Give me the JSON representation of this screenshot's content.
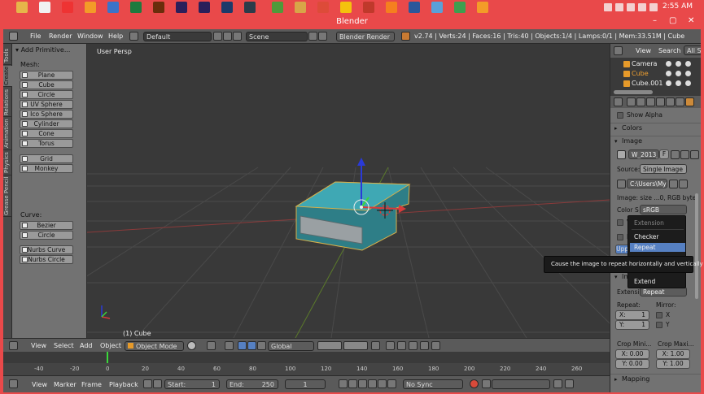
{
  "taskbar": {
    "clock": "2:55 AM",
    "apps": [
      {
        "name": "folder-icon",
        "color": "#e6b64a"
      },
      {
        "name": "gmail-icon",
        "color": "#f1f1f1"
      },
      {
        "name": "pinterest-icon",
        "color": "#e33"
      },
      {
        "name": "vlc-icon",
        "color": "#f39b28"
      },
      {
        "name": "windows-icon",
        "color": "#3b73c8"
      },
      {
        "name": "excel-icon",
        "color": "#1f7a3e"
      },
      {
        "name": "illustrator-icon",
        "color": "#6b2d0b"
      },
      {
        "name": "aftereffects-icon",
        "color": "#2c1f5a"
      },
      {
        "name": "premiere-icon",
        "color": "#2a1f5a"
      },
      {
        "name": "photoshop-icon",
        "color": "#1c3a6a"
      },
      {
        "name": "lightroom-icon",
        "color": "#2b3c4a"
      },
      {
        "name": "app-green-icon",
        "color": "#4f9a3a"
      },
      {
        "name": "folder2-icon",
        "color": "#d8a548"
      },
      {
        "name": "chrome-icon",
        "color": "#dd4b39"
      },
      {
        "name": "chrome2-icon",
        "color": "#f4c20d"
      },
      {
        "name": "app-red-icon",
        "color": "#c0392b"
      },
      {
        "name": "blender-icon",
        "color": "#f57f1f"
      },
      {
        "name": "word-icon",
        "color": "#2b579a"
      },
      {
        "name": "image-icon",
        "color": "#5aa0d8"
      },
      {
        "name": "app-pdf-icon",
        "color": "#3f9f4f"
      },
      {
        "name": "vlc2-icon",
        "color": "#f39b28"
      }
    ]
  },
  "window": {
    "title": "Blender",
    "minimize": "–",
    "maximize": "▢",
    "close": "✕"
  },
  "topbar": {
    "menus": [
      "File",
      "Render",
      "Window",
      "Help"
    ],
    "layout": "Default",
    "scene": "Scene",
    "engine": "Blender Render",
    "stats": "v2.74 | Verts:24 | Faces:16 | Tris:40 | Objects:1/4 | Lamps:0/1 | Mem:33.51M | Cube"
  },
  "toolshelf": {
    "tabs": [
      "Tools",
      "Create",
      "Relations",
      "Animation",
      "Physics",
      "Grease Pencil"
    ],
    "panel_title": "Add Primitive...",
    "mesh_label": "Mesh:",
    "mesh_items": [
      "Plane",
      "Cube",
      "Circle",
      "UV Sphere",
      "Ico Sphere",
      "Cylinder",
      "Cone",
      "Torus"
    ],
    "extra_items": [
      "Grid",
      "Monkey"
    ],
    "curve_label": "Curve:",
    "curve_items": [
      "Bezier",
      "Circle"
    ],
    "nurbs_items": [
      "Nurbs Curve",
      "Nurbs Circle"
    ]
  },
  "viewport": {
    "label": "User Persp",
    "object_label": "(1) Cube"
  },
  "viewport_header": {
    "menus": [
      "View",
      "Select",
      "Add",
      "Object"
    ],
    "mode": "Object Mode",
    "orientation": "Global"
  },
  "timeline": {
    "ticks": [
      "-40",
      "-20",
      "0",
      "20",
      "40",
      "60",
      "80",
      "100",
      "120",
      "140",
      "160",
      "180",
      "200",
      "220",
      "240",
      "260"
    ],
    "menus": [
      "View",
      "Marker",
      "Frame",
      "Playback"
    ],
    "start_label": "Start:",
    "start_value": "1",
    "end_label": "End:",
    "end_value": "250",
    "current_frame": "1",
    "sync": "No Sync"
  },
  "outliner": {
    "view": "View",
    "search": "Search",
    "filter": "All Sc",
    "items": [
      "Camera",
      "Cube",
      "Cube.001"
    ]
  },
  "properties": {
    "show_alpha": "Show Alpha",
    "colors": "Colors",
    "image": "Image",
    "image_name": "W_2013_",
    "image_f": "F",
    "source_label": "Source:",
    "source_value": "Single Image",
    "path": "C:\\Users\\My ...",
    "image_info": "Image: size ...0, RGB byte",
    "colorspace_label": "Color S",
    "colorspace_value": "sRGB",
    "cb1": "Vi",
    "cb2": "Fi",
    "up_label": "Uppe",
    "img_label": "Ima",
    "extension_label": "Extensi",
    "extension_value": "Repeat",
    "repeat_label": "Repeat:",
    "mirror_label": "Mirror:",
    "repeat_x": "X:",
    "repeat_x_val": "1",
    "repeat_y": "Y:",
    "repeat_y_val": "1",
    "mirror_x": "X",
    "mirror_y": "Y",
    "crop_min_label": "Crop Mini...",
    "crop_max_label": "Crop Maxi...",
    "crop_min_x": "X: 0.00",
    "crop_min_y": "Y: 0.00",
    "crop_max_x": "X: 1.00",
    "crop_max_y": "Y: 1.00",
    "mapping": "Mapping"
  },
  "dropdown": {
    "title": "Extension",
    "items": [
      "Checker",
      "Repeat",
      "Extend"
    ],
    "selected": "Repeat"
  },
  "tooltip": "Cause the image to repeat horizontally and vertically"
}
